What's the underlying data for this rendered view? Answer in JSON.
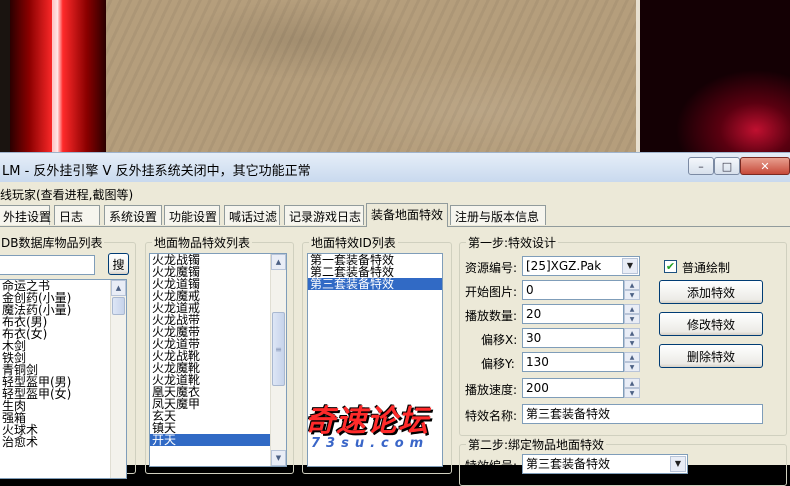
{
  "window": {
    "title": "LM - 反外挂引擎 V 反外挂系统关闭中，其它功能正常",
    "min_glyph": "–",
    "max_glyph": "□",
    "close_glyph": "✕"
  },
  "menu": {
    "item": "线玩家(查看进程,截图等)"
  },
  "tabs": [
    {
      "label": "外挂设置"
    },
    {
      "label": "日志"
    },
    {
      "label": "系统设置"
    },
    {
      "label": "功能设置"
    },
    {
      "label": "喊话过滤"
    },
    {
      "label": "记录游戏日志"
    },
    {
      "label": "装备地面特效"
    },
    {
      "label": "注册与版本信息"
    }
  ],
  "active_tab": "装备地面特效",
  "db_panel": {
    "title": "DB数据库物品列表",
    "search_button": "搜",
    "search_value": "",
    "items": [
      "命运之书",
      "金创药(小量)",
      "魔法药(小量)",
      "布衣(男)",
      "布衣(女)",
      "木剑",
      "铁剑",
      "青铜剑",
      "轻型盔甲(男)",
      "轻型盔甲(女)",
      "生肉",
      "强箱",
      "火球术",
      "治愈术"
    ]
  },
  "ground_panel": {
    "title": "地面物品特效列表",
    "items": [
      "火龙战镯",
      "火龙魔镯",
      "火龙道镯",
      "火龙魔戒",
      "火龙道戒",
      "火龙战带",
      "火龙魔带",
      "火龙道带",
      "火龙战靴",
      "火龙魔靴",
      "火龙道靴",
      "凰天魔衣",
      "凤天魔甲",
      "玄天",
      "镇天",
      "开天"
    ],
    "selected": "开天"
  },
  "effect_panel": {
    "title": "地面特效ID列表",
    "items": [
      "第一套装备特效",
      "第二套装备特效",
      "第三套装备特效"
    ],
    "selected": "第三套装备特效"
  },
  "step1": {
    "title": "第一步:特效设计",
    "resource_label": "资源编号:",
    "resource_value": "[25]XGZ.Pak",
    "start_label": "开始图片:",
    "start_value": "0",
    "count_label": "播放数量:",
    "count_value": "20",
    "offset_x_label": "偏移X:",
    "offset_x_value": "30",
    "offset_y_label": "偏移Y:",
    "offset_y_value": "130",
    "speed_label": "播放速度:",
    "speed_value": "200",
    "name_label": "特效名称:",
    "name_value": "第三套装备特效",
    "normal_draw_label": "普通绘制",
    "normal_draw_checked": true,
    "add_button": "添加特效",
    "edit_button": "修改特效",
    "delete_button": "删除特效"
  },
  "step2": {
    "title": "第二步:绑定物品地面特效",
    "effect_label": "特效编号:",
    "effect_value": "第三套装备特效"
  },
  "watermark": {
    "main": "奇速论坛",
    "sub": "73su.com"
  }
}
